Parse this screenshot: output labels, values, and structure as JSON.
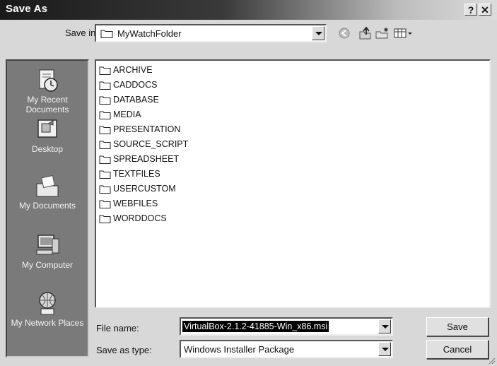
{
  "window": {
    "title": "Save As",
    "help_glyph": "?",
    "close_glyph": "✕"
  },
  "save_in": {
    "label": "Save in:",
    "value": "MyWatchFolder"
  },
  "toolbar_icons": [
    "back-icon",
    "up-folder-icon",
    "new-folder-icon",
    "views-menu-icon"
  ],
  "places": [
    {
      "label": "My Recent Documents",
      "icon": "recent-documents-icon"
    },
    {
      "label": "Desktop",
      "icon": "desktop-icon"
    },
    {
      "label": "My Documents",
      "icon": "my-documents-icon"
    },
    {
      "label": "My Computer",
      "icon": "my-computer-icon"
    },
    {
      "label": "My Network Places",
      "icon": "network-places-icon"
    }
  ],
  "folders": [
    "ARCHIVE",
    "CADDOCS",
    "DATABASE",
    "MEDIA",
    "PRESENTATION",
    "SOURCE_SCRIPT",
    "SPREADSHEET",
    "TEXTFILES",
    "USERCUSTOM",
    "WEBFILES",
    "WORDDOCS"
  ],
  "file_name": {
    "label": "File name:",
    "value": "VirtualBox-2.1.2-41885-Win_x86.msi"
  },
  "save_as_type": {
    "label": "Save as type:",
    "value": "Windows Installer Package"
  },
  "buttons": {
    "save": "Save",
    "cancel": "Cancel"
  }
}
